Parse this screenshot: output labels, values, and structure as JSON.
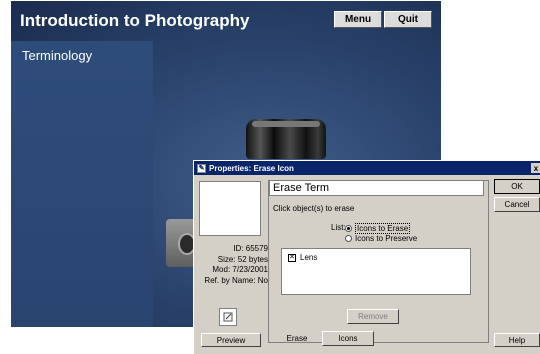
{
  "app": {
    "title": "Introduction to Photography",
    "menu_label": "Menu",
    "quit_label": "Quit",
    "section_label": "Terminology"
  },
  "dialog": {
    "title": "Properties: Erase Icon",
    "icon_name": "Erase Term",
    "instruction": "Click object(s) to erase",
    "list_label": "List:",
    "radio_options": [
      "Icons to Erase",
      "Icons to Preserve"
    ],
    "selected_option": "Icons to Erase",
    "list_items": [
      {
        "label": "Lens",
        "checked": true
      }
    ],
    "remove_label": "Remove",
    "info": {
      "id": "ID: 65579",
      "size": "Size: 52 bytes",
      "mod": "Mod: 7/23/2001",
      "ref": "Ref. by Name: No"
    },
    "preview_label": "Preview",
    "tabs": [
      "Erase",
      "Icons"
    ],
    "active_tab": "Icons",
    "ok_label": "OK",
    "cancel_label": "Cancel",
    "help_label": "Help",
    "close_glyph": "x"
  }
}
